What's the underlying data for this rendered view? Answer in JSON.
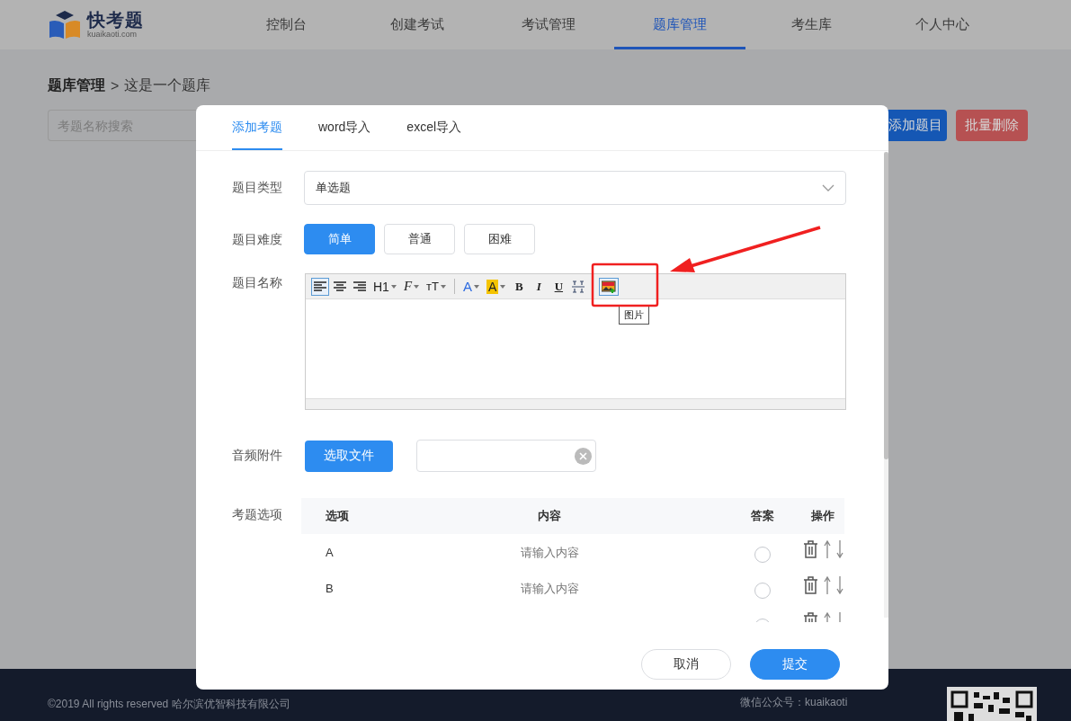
{
  "header": {
    "logo": {
      "name": "快考题",
      "domain": "kuaikaoti.com"
    },
    "nav": [
      {
        "label": "控制台",
        "selected": false
      },
      {
        "label": "创建考试",
        "selected": false
      },
      {
        "label": "考试管理",
        "selected": false
      },
      {
        "label": "题库管理",
        "selected": true
      },
      {
        "label": "考生库",
        "selected": false
      },
      {
        "label": "个人中心",
        "selected": false
      }
    ]
  },
  "breadcrumb": {
    "parent": "题库管理",
    "separator": ">",
    "current": "这是一个题库"
  },
  "search": {
    "placeholder": "考题名称搜索"
  },
  "actions": [
    {
      "label": "添加题目",
      "kind": "primary"
    },
    {
      "label": "批量删除",
      "kind": "danger"
    }
  ],
  "modal": {
    "tabs": [
      {
        "label": "添加考题",
        "selected": true
      },
      {
        "label": "word导入",
        "selected": false
      },
      {
        "label": "excel导入",
        "selected": false
      }
    ],
    "type": {
      "label": "题目类型",
      "value": "单选题"
    },
    "difficulty": {
      "label": "题目难度",
      "options": [
        {
          "label": "简单",
          "selected": true
        },
        {
          "label": "普通",
          "selected": false
        },
        {
          "label": "困难",
          "selected": false
        }
      ]
    },
    "name": {
      "label": "题目名称",
      "tooltip": "图片",
      "toolbar": [
        {
          "kind": "align-left",
          "selected": true
        },
        {
          "kind": "align-center",
          "selected": false
        },
        {
          "kind": "align-right",
          "selected": false
        },
        {
          "kind": "heading",
          "label": "H1",
          "selected": false
        },
        {
          "kind": "font",
          "label": "F",
          "selected": false
        },
        {
          "kind": "size",
          "label": "ᴛT",
          "selected": false
        },
        {
          "kind": "separator"
        },
        {
          "kind": "color",
          "label": "A",
          "selected": false
        },
        {
          "kind": "highlight",
          "label": "A",
          "selected": false
        },
        {
          "kind": "bold",
          "label": "B",
          "selected": false
        },
        {
          "kind": "italic",
          "label": "I",
          "selected": false
        },
        {
          "kind": "underline",
          "label": "U",
          "selected": false
        },
        {
          "kind": "strike",
          "selected": false
        },
        {
          "kind": "separator"
        },
        {
          "kind": "image",
          "selected": true
        }
      ]
    },
    "audio": {
      "label": "音频附件",
      "button": "选取文件"
    },
    "options": {
      "label": "考题选项",
      "columns": [
        "选项",
        "内容",
        "答案",
        "操作"
      ],
      "rows": [
        {
          "option": "A",
          "placeholder": "请输入内容",
          "selected": false
        },
        {
          "option": "B",
          "placeholder": "请输入内容",
          "selected": false
        },
        {
          "selected": false
        }
      ]
    },
    "buttons": [
      {
        "label": "取消",
        "kind": "secondary"
      },
      {
        "label": "提交",
        "kind": "primary"
      }
    ]
  },
  "footer": {
    "copyright": "©2019 All rights reserved 哈尔滨优智科技有限公司",
    "wechat": "微信公众号：kuaikaoti"
  }
}
